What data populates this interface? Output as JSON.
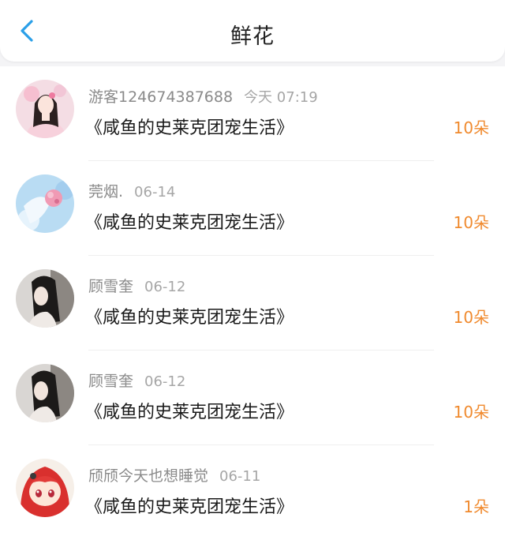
{
  "header": {
    "title": "鲜花",
    "back_icon": "chevron-left-icon"
  },
  "colors": {
    "accent": "#2a9fe8",
    "amount": "#f08a2e"
  },
  "items": [
    {
      "username": "游客124674387688",
      "date": "今天 07:19",
      "book": "《咸鱼的史莱克团宠生活》",
      "amount": "10朵"
    },
    {
      "username": "莞烟.",
      "date": "06-14",
      "book": "《咸鱼的史莱克团宠生活》",
      "amount": "10朵"
    },
    {
      "username": "顾雪奎",
      "date": "06-12",
      "book": "《咸鱼的史莱克团宠生活》",
      "amount": "10朵"
    },
    {
      "username": "顾雪奎",
      "date": "06-12",
      "book": "《咸鱼的史莱克团宠生活》",
      "amount": "10朵"
    },
    {
      "username": "颀颀今天也想睡觉",
      "date": "06-11",
      "book": "《咸鱼的史莱克团宠生活》",
      "amount": "1朵"
    }
  ]
}
